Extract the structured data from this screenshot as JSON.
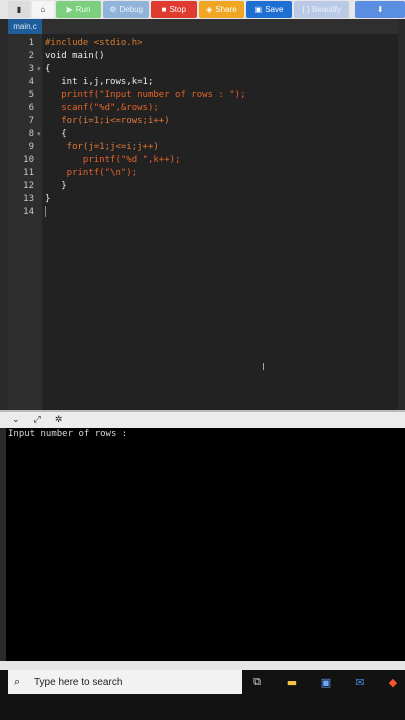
{
  "toolbar": {
    "file_icon": "file-icon",
    "home_icon": "home-icon",
    "run_label": "Run",
    "debug_label": "Debug",
    "stop_label": "Stop",
    "share_label": "Share",
    "save_label": "Save",
    "beautify_label": "{ } Beautify",
    "download_icon": "download-icon"
  },
  "tabs": [
    {
      "label": "main.c"
    }
  ],
  "editor": {
    "lines": [
      {
        "n": "1",
        "text": "#include <stdio.h>"
      },
      {
        "n": "2",
        "text": "void main()"
      },
      {
        "n": "3",
        "text": "{"
      },
      {
        "n": "4",
        "text": "   int i,j,rows,k=1;"
      },
      {
        "n": "5",
        "text": "   printf(\"Input number of rows : \");"
      },
      {
        "n": "6",
        "text": "   scanf(\"%d\",&rows);"
      },
      {
        "n": "7",
        "text": "   for(i=1;i<=rows;i++)"
      },
      {
        "n": "8",
        "text": "   {"
      },
      {
        "n": "9",
        "text": "    for(j=1;j<=i;j++)"
      },
      {
        "n": "10",
        "text": "       printf(\"%d \",k++);"
      },
      {
        "n": "11",
        "text": "    printf(\"\\n\");"
      },
      {
        "n": "12",
        "text": "   }"
      },
      {
        "n": "13",
        "text": "}"
      },
      {
        "n": "14",
        "text": ""
      }
    ]
  },
  "console": {
    "output": "Input number of rows : "
  },
  "taskbar": {
    "search_placeholder": "Type here to search",
    "icons": [
      "task-view-icon",
      "file-explorer-icon",
      "store-icon",
      "mail-icon",
      "brave-browser-icon"
    ]
  },
  "colors": {
    "run": "#7dcf7d",
    "debug": "#8fb3d9",
    "stop": "#e03b2f",
    "share": "#f1a623",
    "save": "#1d6fd2",
    "tab_active": "#1f5e9b",
    "syntax_orange": "#e6632b"
  }
}
